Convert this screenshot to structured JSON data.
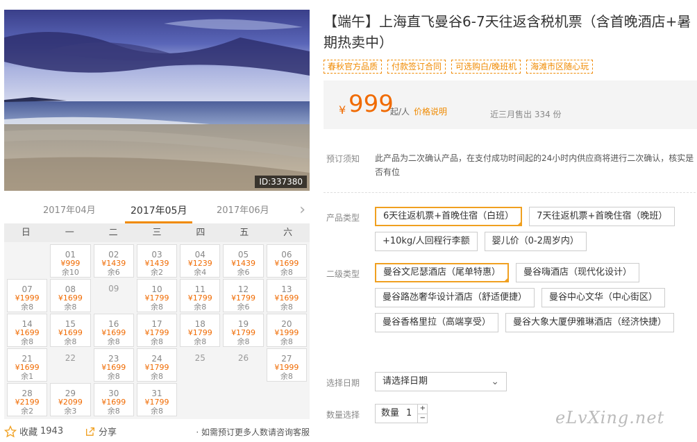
{
  "hero": {
    "id_label": "ID:337380"
  },
  "calendar": {
    "months": [
      "2017年04月",
      "2017年05月",
      "2017年06月"
    ],
    "weekdays": [
      "日",
      "一",
      "二",
      "三",
      "四",
      "五",
      "六"
    ],
    "rows": [
      [
        null,
        {
          "d": "01",
          "p": "¥999",
          "s": "余10"
        },
        {
          "d": "02",
          "p": "¥1439",
          "s": "余6"
        },
        {
          "d": "03",
          "p": "¥1439",
          "s": "余2"
        },
        {
          "d": "04",
          "p": "¥1239",
          "s": "余4"
        },
        {
          "d": "05",
          "p": "¥1439",
          "s": "余6"
        },
        {
          "d": "06",
          "p": "¥1699",
          "s": "余8"
        }
      ],
      [
        {
          "d": "07",
          "p": "¥1999",
          "s": "余8"
        },
        {
          "d": "08",
          "p": "¥1699",
          "s": "余8"
        },
        {
          "d": "09"
        },
        {
          "d": "10",
          "p": "¥1799",
          "s": "余8"
        },
        {
          "d": "11",
          "p": "¥1799",
          "s": "余8"
        },
        {
          "d": "12",
          "p": "¥1799",
          "s": "余6"
        },
        {
          "d": "13",
          "p": "¥1699",
          "s": "余8"
        }
      ],
      [
        {
          "d": "14",
          "p": "¥1699",
          "s": "余8"
        },
        {
          "d": "15",
          "p": "¥1699",
          "s": "余8"
        },
        {
          "d": "16",
          "p": "¥1699",
          "s": "余8"
        },
        {
          "d": "17",
          "p": "¥1799",
          "s": "余8"
        },
        {
          "d": "18",
          "p": "¥1799",
          "s": "余8"
        },
        {
          "d": "19",
          "p": "¥1799",
          "s": "余8"
        },
        {
          "d": "20",
          "p": "¥1999",
          "s": "余8"
        }
      ],
      [
        {
          "d": "21",
          "p": "¥1699",
          "s": "余1"
        },
        {
          "d": "22"
        },
        {
          "d": "23",
          "p": "¥1699",
          "s": "余8"
        },
        {
          "d": "24",
          "p": "¥1799",
          "s": "余8"
        },
        {
          "d": "25"
        },
        {
          "d": "26"
        },
        {
          "d": "27",
          "p": "¥1999",
          "s": "余8"
        }
      ],
      [
        {
          "d": "28",
          "p": "¥2199",
          "s": "余2"
        },
        {
          "d": "29",
          "p": "¥2099",
          "s": "余3"
        },
        {
          "d": "30",
          "p": "¥1699",
          "s": "余8"
        },
        {
          "d": "31",
          "p": "¥1799",
          "s": "余8"
        },
        null,
        null,
        null
      ]
    ]
  },
  "footer": {
    "fav_label": "收藏",
    "fav_count": "1943",
    "share_label": "分享",
    "note": "· 如需预订更多人数请咨询客服"
  },
  "product": {
    "title": "【端午】上海直飞曼谷6-7天往返含税机票（含首晚酒店+暑期热卖中）",
    "tags": [
      "春秋官方品质",
      "付款签订合同",
      "可选购白/晚班机",
      "海滩市区随心玩"
    ],
    "currency": "¥",
    "price": "999",
    "per": "起/人",
    "price_explain": "价格说明",
    "sold": "近三月售出 334 份",
    "notice_label": "预订须知",
    "notice_text": "此产品为二次确认产品，在支付成功时间起的24小时内供应商将进行二次确认，核实是否有位",
    "type_label": "产品类型",
    "types": [
      "6天往返机票+首晚住宿（白班）",
      "7天往返机票+首晚住宿（晚班）",
      "+10kg/人回程行李额",
      "婴儿价（0-2周岁内）"
    ],
    "sub_label": "二级类型",
    "subs": [
      "曼谷文尼瑟酒店（尾单特惠）",
      "曼谷嗨酒店（现代化设计）",
      "曼谷路氹奢华设计酒店（舒适便捷）",
      "曼谷中心文华（中心街区）",
      "曼谷香格里拉（高端享受）",
      "曼谷大象大厦伊雅琳酒店（经济快捷）"
    ],
    "date_label": "选择日期",
    "date_placeholder": "请选择日期",
    "qty_label": "数量选择",
    "qty_text": "数量",
    "qty_value": "1"
  },
  "watermark": "eLvXing.net"
}
